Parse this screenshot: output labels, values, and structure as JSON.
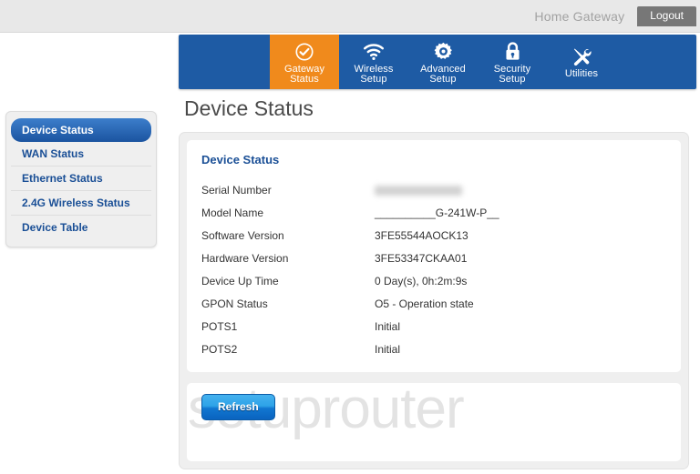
{
  "header": {
    "site_label": "Home Gateway",
    "logout_label": "Logout"
  },
  "nav": {
    "items": [
      {
        "label_line1": "Gateway",
        "label_line2": "Status",
        "icon": "check-circle-icon",
        "active": true
      },
      {
        "label_line1": "Wireless",
        "label_line2": "Setup",
        "icon": "wifi-icon",
        "active": false
      },
      {
        "label_line1": "Advanced",
        "label_line2": "Setup",
        "icon": "gear-icon",
        "active": false
      },
      {
        "label_line1": "Security",
        "label_line2": "Setup",
        "icon": "lock-icon",
        "active": false
      },
      {
        "label_line1": "Utilities",
        "label_line2": "",
        "icon": "tools-icon",
        "active": false
      }
    ],
    "active_color": "#f08a1c",
    "bar_color": "#1e5ba4"
  },
  "sidebar": {
    "items": [
      {
        "label": "Device Status",
        "active": true
      },
      {
        "label": "WAN Status",
        "active": false
      },
      {
        "label": "Ethernet Status",
        "active": false
      },
      {
        "label": "2.4G Wireless Status",
        "active": false
      },
      {
        "label": "Device Table",
        "active": false
      }
    ]
  },
  "main": {
    "page_title": "Device Status",
    "section_heading": "Device Status",
    "rows": [
      {
        "label": "Serial Number",
        "value": "",
        "redacted": true
      },
      {
        "label": "Model Name",
        "value": "__________G-241W-P__",
        "redacted": false
      },
      {
        "label": "Software Version",
        "value": "3FE55544AOCK13",
        "redacted": false
      },
      {
        "label": "Hardware Version",
        "value": "3FE53347CKAA01",
        "redacted": false
      },
      {
        "label": "Device Up Time",
        "value": "0 Day(s), 0h:2m:9s",
        "redacted": false
      },
      {
        "label": "GPON Status",
        "value": "O5 - Operation state",
        "redacted": false
      },
      {
        "label": "POTS1",
        "value": "Initial",
        "redacted": false
      },
      {
        "label": "POTS2",
        "value": "Initial",
        "redacted": false
      }
    ],
    "refresh_label": "Refresh"
  },
  "watermark": {
    "text": "setuprouter"
  }
}
